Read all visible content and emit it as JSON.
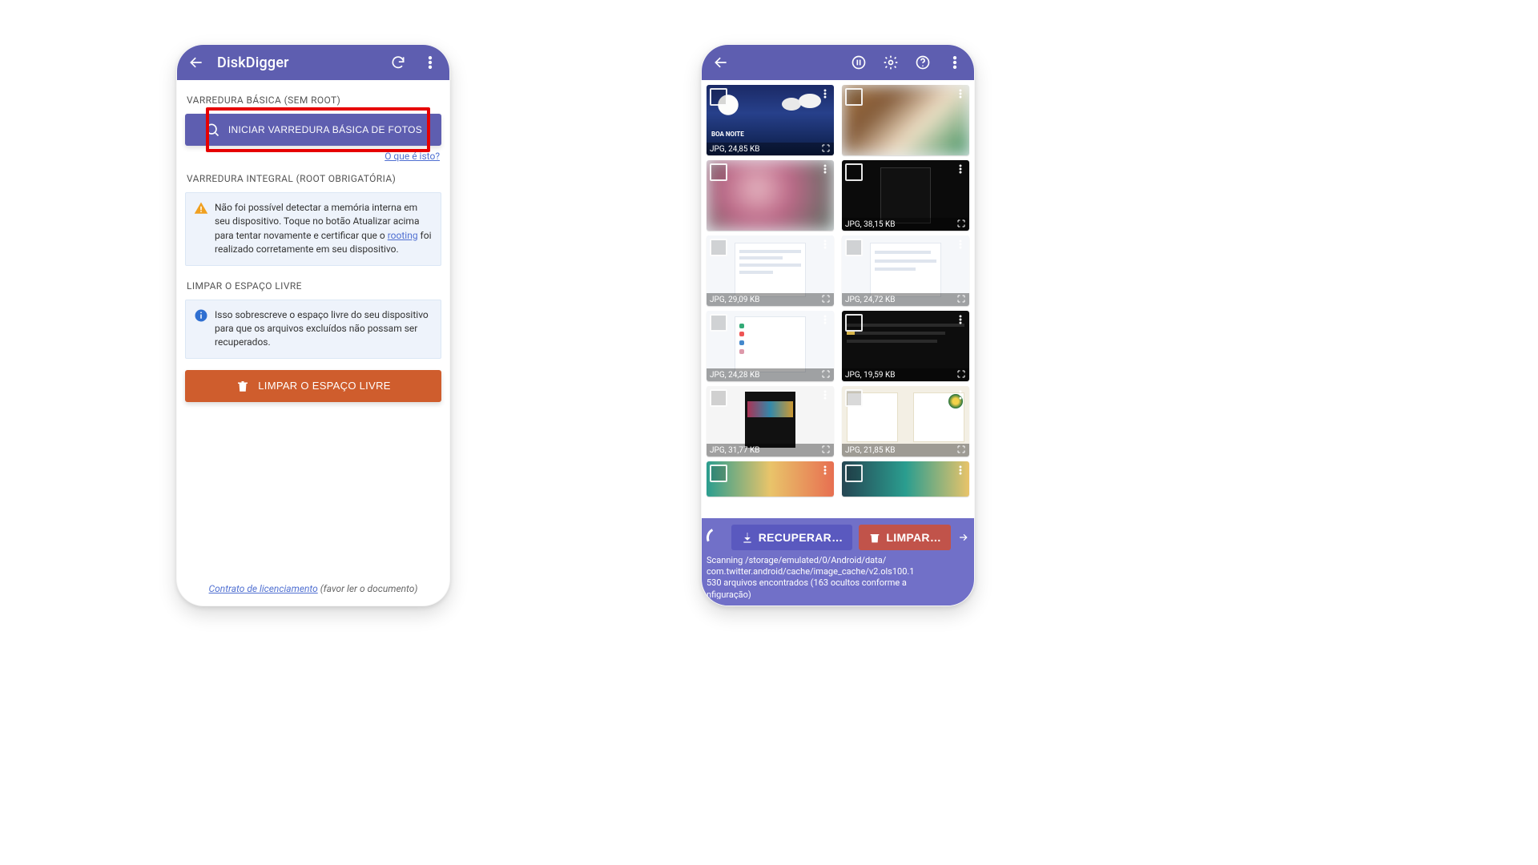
{
  "left": {
    "appbar": {
      "title": "DiskDigger"
    },
    "basic": {
      "heading": "VARREDURA BÁSICA (SEM ROOT)",
      "button": "INICIAR VARREDURA BÁSICA DE FOTOS",
      "help_link": "O que é isto?"
    },
    "full": {
      "heading": "VARREDURA INTEGRAL (ROOT OBRIGATÓRIA)",
      "warn_text_pre": "Não foi possível detectar a memória interna em seu dispositivo. Toque no botão Atualizar acima para tentar novamente e certificar que o ",
      "warn_link": "rooting",
      "warn_text_post": " foi realizado corretamente em seu dispositivo."
    },
    "wipe": {
      "heading": "LIMPAR O ESPAÇO LIVRE",
      "info_text": "Isso sobrescreve o espaço livre do seu dispositivo para que os arquivos excluídos não possam ser recuperados.",
      "button": "LIMPAR O ESPAÇO LIVRE"
    },
    "footer": {
      "link": "Contrato de licenciamento",
      "paren": " (favor ler o documento)"
    }
  },
  "right": {
    "action_recover": "RECUPERAR…",
    "action_clean": "LIMPAR…",
    "log_line1": "Scanning /storage/emulated/0/Android/data/",
    "log_line2": "com.twitter.android/cache/image_cache/v2.ols100.1",
    "log_line3": "530 arquivos encontrados (163 ocultos conforme a",
    "log_line4": "nfiguração)",
    "thumbs": [
      {
        "size": "JPG, 24,85 KB"
      },
      {
        "size": ""
      },
      {
        "size": ""
      },
      {
        "size": "JPG, 38,15 KB"
      },
      {
        "size": "JPG, 29,09 KB"
      },
      {
        "size": "JPG, 24,72 KB"
      },
      {
        "size": "JPG, 24,28 KB"
      },
      {
        "size": "JPG, 19,59 KB"
      },
      {
        "size": "JPG, 31,77 KB"
      },
      {
        "size": "JPG, 21,85 KB"
      },
      {
        "size": ""
      },
      {
        "size": ""
      }
    ]
  }
}
